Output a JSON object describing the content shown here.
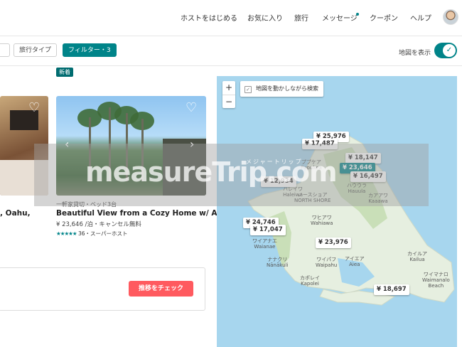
{
  "nav": {
    "items": [
      "ホストをはじめる",
      "お気に入り",
      "旅行",
      "メッセージ",
      "クーポン",
      "ヘルプ"
    ],
    "accent": "#008489"
  },
  "filters": {
    "chips": [
      "旅行タイプ",
      "フィルター・3"
    ],
    "map_toggle_label": "地図を表示",
    "map_toggle_on": true
  },
  "listings": {
    "partial_title": ", Oahu,",
    "badge": "新着",
    "subtitle": "一軒家貸切・ベッド3台",
    "title": "Beautiful View from a Cozy Home w/ A/C",
    "price": "¥ 23,646 /泊・キャンセル無料",
    "stars": "★★★★★",
    "rating_text": "36・スーパーホスト",
    "heart_icon": "heart-outline-icon"
  },
  "trend": {
    "button_label": "推移をチェック",
    "button_color": "#ff5a5f"
  },
  "map": {
    "zoom_in": "+",
    "zoom_out": "−",
    "search_while_moving": "地図を動かしながら検索",
    "pins": [
      {
        "label": "¥ 25,976",
        "selected": false
      },
      {
        "label": "¥ 17,487",
        "selected": false
      },
      {
        "label": "¥ 18,147",
        "selected": false
      },
      {
        "label": "¥ 23,646",
        "selected": true
      },
      {
        "label": "¥ 16,497",
        "selected": false
      },
      {
        "label": "¥ 12,934",
        "selected": false
      },
      {
        "label": "¥ 24,746",
        "selected": false
      },
      {
        "label": "¥ 17,047",
        "selected": false
      },
      {
        "label": "¥ 23,976",
        "selected": false
      },
      {
        "label": "¥ 18,697",
        "selected": false
      }
    ],
    "places": {
      "pupukea": "ププケア\nPupukea",
      "haleiwa": "ハレイワ\nHaleiwa",
      "north_shore": "ノースショア\nNORTH SHORE",
      "hauula": "ハウウラ\nHauula",
      "kaaawa": "カアアワ\nKaaawa",
      "wahiawa": "ワヒアワ\nWahiawa",
      "waianae": "ワイアナエ\nWaianae",
      "nanakuli": "ナナクリ\nNānākuli",
      "waipahu": "ワイパフ\nWaipahu",
      "aiea": "アイエア\nAiea",
      "kailua": "カイルア\nKailua",
      "kapolei": "カポレイ\nKapolei",
      "waimanalo": "ワイマナロ\nWaimanalo\nBeach"
    }
  },
  "watermark": {
    "text": "measureTrip.com",
    "sub": "メジャートリップ"
  }
}
